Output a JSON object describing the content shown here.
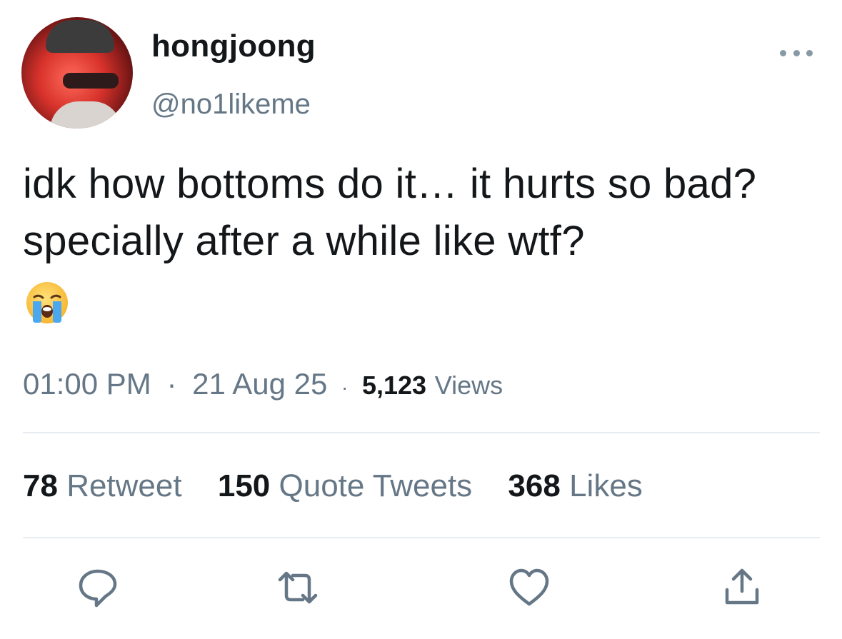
{
  "user": {
    "display_name": "hongjoong",
    "handle": "@no1likeme",
    "avatar_icon": "profile-photo-avatar"
  },
  "menu": {
    "icon": "more-dots-icon"
  },
  "tweet": {
    "text": "idk how bottoms do it… it hurts so bad? specially after a while like wtf?",
    "emoji": "loudly-crying-face-emoji"
  },
  "meta": {
    "time": "01:00 PM",
    "separator": "·",
    "date": "21 Aug 25",
    "views_count": "5,123",
    "views_label": "Views"
  },
  "stats": {
    "retweets_count": "78",
    "retweets_label": "Retweet",
    "quotes_count": "150",
    "quotes_label": "Quote Tweets",
    "likes_count": "368",
    "likes_label": "Likes"
  },
  "actions": [
    "reply-icon",
    "retweet-icon",
    "like-heart-icon",
    "share-icon"
  ],
  "colors": {
    "text": "#14171a",
    "secondary": "#657786",
    "icon": "#657786",
    "divider": "#e6ecf0"
  }
}
